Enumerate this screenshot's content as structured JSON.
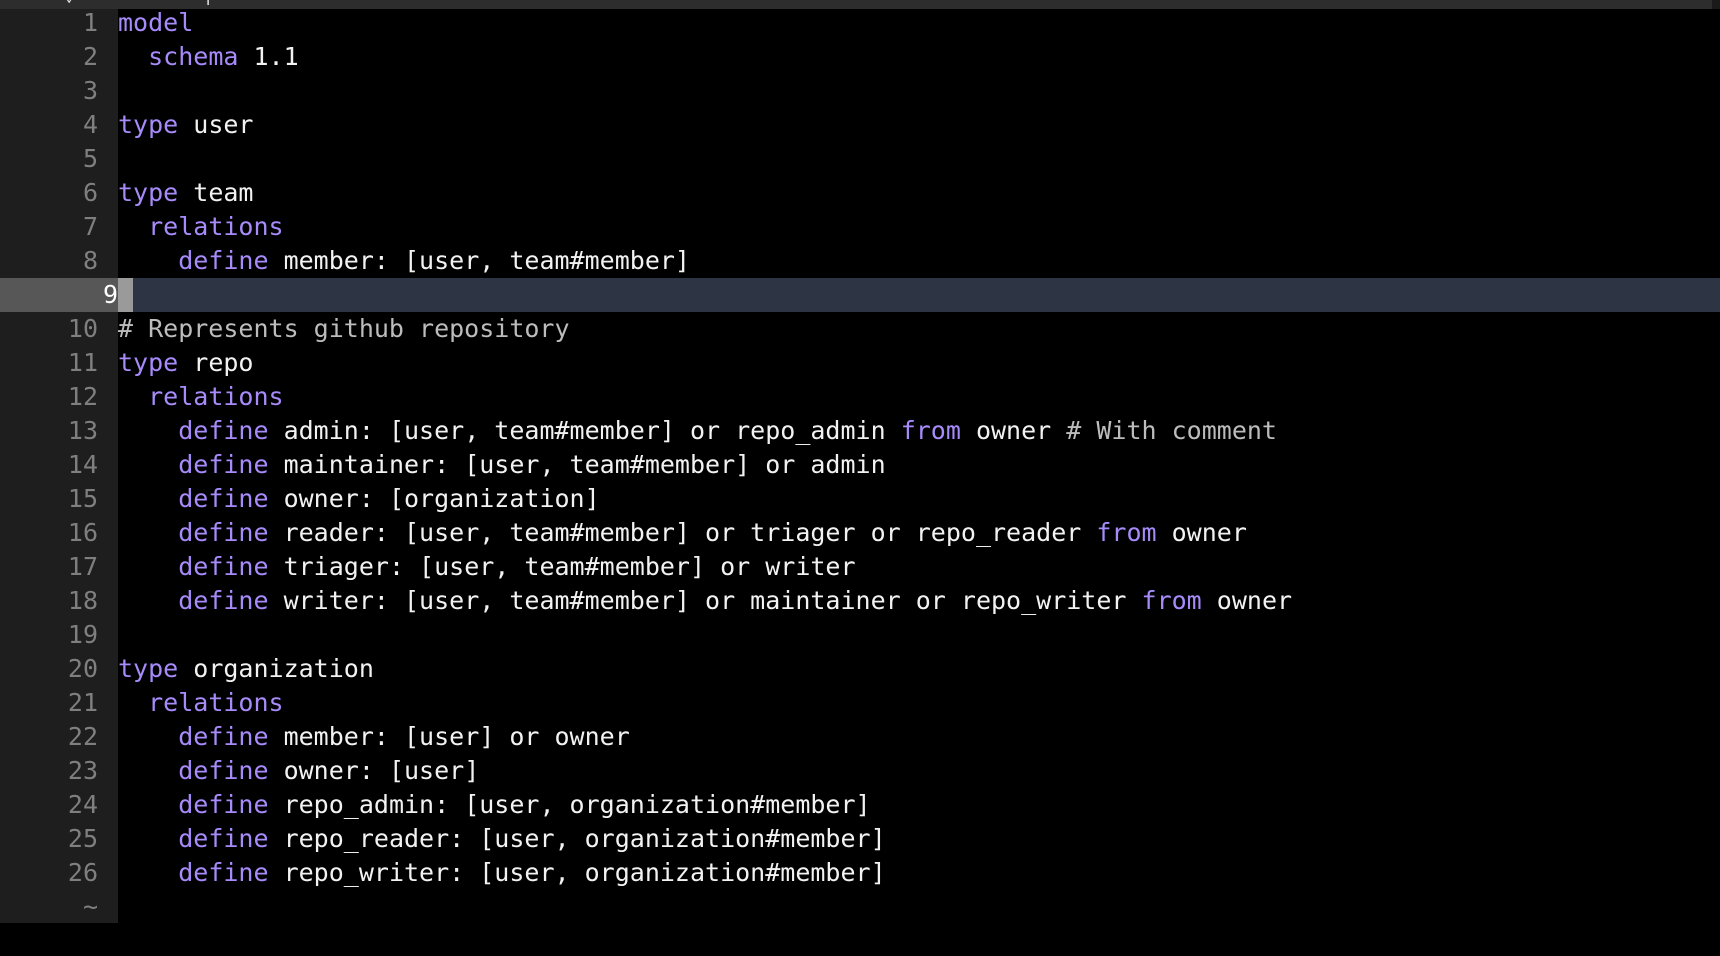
{
  "window": {
    "tab_strip_visible_fragment": "⌄",
    "tab_strip_right_fragment": "|   •  •  •"
  },
  "editor": {
    "background_color": "#000000",
    "gutter_background_color": "#1e1e1e",
    "current_line_background_color": "#2d3443",
    "current_line_number_background_color": "#575757",
    "line_number_color": "#7f7f7f",
    "keyword_color": "#a78bfa",
    "comment_color": "#bcbcbc",
    "text_color": "#f2f2f2",
    "cursor_color": "#9a9a9a",
    "cursor_line": 9,
    "cursor_column": 1,
    "empty_line_marker": "~",
    "language": "OpenFGA model (fga)",
    "lines": [
      {
        "n": "1",
        "tokens": [
          {
            "t": "model",
            "c": "kw"
          }
        ]
      },
      {
        "n": "2",
        "tokens": [
          {
            "t": "  ",
            "c": "txt"
          },
          {
            "t": "schema",
            "c": "kw"
          },
          {
            "t": " 1.1",
            "c": "txt"
          }
        ]
      },
      {
        "n": "3",
        "tokens": []
      },
      {
        "n": "4",
        "tokens": [
          {
            "t": "type",
            "c": "kw"
          },
          {
            "t": " user",
            "c": "txt"
          }
        ]
      },
      {
        "n": "5",
        "tokens": []
      },
      {
        "n": "6",
        "tokens": [
          {
            "t": "type",
            "c": "kw"
          },
          {
            "t": " team",
            "c": "txt"
          }
        ]
      },
      {
        "n": "7",
        "tokens": [
          {
            "t": "  ",
            "c": "txt"
          },
          {
            "t": "relations",
            "c": "kw"
          }
        ]
      },
      {
        "n": "8",
        "tokens": [
          {
            "t": "    ",
            "c": "txt"
          },
          {
            "t": "define",
            "c": "kw"
          },
          {
            "t": " member: [user, team#member]",
            "c": "txt"
          }
        ]
      },
      {
        "n": "9",
        "tokens": []
      },
      {
        "n": "10",
        "tokens": [
          {
            "t": "# Represents github repository",
            "c": "cmt"
          }
        ]
      },
      {
        "n": "11",
        "tokens": [
          {
            "t": "type",
            "c": "kw"
          },
          {
            "t": " repo",
            "c": "txt"
          }
        ]
      },
      {
        "n": "12",
        "tokens": [
          {
            "t": "  ",
            "c": "txt"
          },
          {
            "t": "relations",
            "c": "kw"
          }
        ]
      },
      {
        "n": "13",
        "tokens": [
          {
            "t": "    ",
            "c": "txt"
          },
          {
            "t": "define",
            "c": "kw"
          },
          {
            "t": " admin: [user, team#member] or repo_admin ",
            "c": "txt"
          },
          {
            "t": "from",
            "c": "kw"
          },
          {
            "t": " owner ",
            "c": "txt"
          },
          {
            "t": "# With comment",
            "c": "cmt"
          }
        ]
      },
      {
        "n": "14",
        "tokens": [
          {
            "t": "    ",
            "c": "txt"
          },
          {
            "t": "define",
            "c": "kw"
          },
          {
            "t": " maintainer: [user, team#member] or admin",
            "c": "txt"
          }
        ]
      },
      {
        "n": "15",
        "tokens": [
          {
            "t": "    ",
            "c": "txt"
          },
          {
            "t": "define",
            "c": "kw"
          },
          {
            "t": " owner: [organization]",
            "c": "txt"
          }
        ]
      },
      {
        "n": "16",
        "tokens": [
          {
            "t": "    ",
            "c": "txt"
          },
          {
            "t": "define",
            "c": "kw"
          },
          {
            "t": " reader: [user, team#member] or triager or repo_reader ",
            "c": "txt"
          },
          {
            "t": "from",
            "c": "kw"
          },
          {
            "t": " owner",
            "c": "txt"
          }
        ]
      },
      {
        "n": "17",
        "tokens": [
          {
            "t": "    ",
            "c": "txt"
          },
          {
            "t": "define",
            "c": "kw"
          },
          {
            "t": " triager: [user, team#member] or writer",
            "c": "txt"
          }
        ]
      },
      {
        "n": "18",
        "tokens": [
          {
            "t": "    ",
            "c": "txt"
          },
          {
            "t": "define",
            "c": "kw"
          },
          {
            "t": " writer: [user, team#member] or maintainer or repo_writer ",
            "c": "txt"
          },
          {
            "t": "from",
            "c": "kw"
          },
          {
            "t": " owner",
            "c": "txt"
          }
        ]
      },
      {
        "n": "19",
        "tokens": []
      },
      {
        "n": "20",
        "tokens": [
          {
            "t": "type",
            "c": "kw"
          },
          {
            "t": " organization",
            "c": "txt"
          }
        ]
      },
      {
        "n": "21",
        "tokens": [
          {
            "t": "  ",
            "c": "txt"
          },
          {
            "t": "relations",
            "c": "kw"
          }
        ]
      },
      {
        "n": "22",
        "tokens": [
          {
            "t": "    ",
            "c": "txt"
          },
          {
            "t": "define",
            "c": "kw"
          },
          {
            "t": " member: [user] or owner",
            "c": "txt"
          }
        ]
      },
      {
        "n": "23",
        "tokens": [
          {
            "t": "    ",
            "c": "txt"
          },
          {
            "t": "define",
            "c": "kw"
          },
          {
            "t": " owner: [user]",
            "c": "txt"
          }
        ]
      },
      {
        "n": "24",
        "tokens": [
          {
            "t": "    ",
            "c": "txt"
          },
          {
            "t": "define",
            "c": "kw"
          },
          {
            "t": " repo_admin: [user, organization#member]",
            "c": "txt"
          }
        ]
      },
      {
        "n": "25",
        "tokens": [
          {
            "t": "    ",
            "c": "txt"
          },
          {
            "t": "define",
            "c": "kw"
          },
          {
            "t": " repo_reader: [user, organization#member]",
            "c": "txt"
          }
        ]
      },
      {
        "n": "26",
        "tokens": [
          {
            "t": "    ",
            "c": "txt"
          },
          {
            "t": "define",
            "c": "kw"
          },
          {
            "t": " repo_writer: [user, organization#member]",
            "c": "txt"
          }
        ]
      }
    ]
  }
}
